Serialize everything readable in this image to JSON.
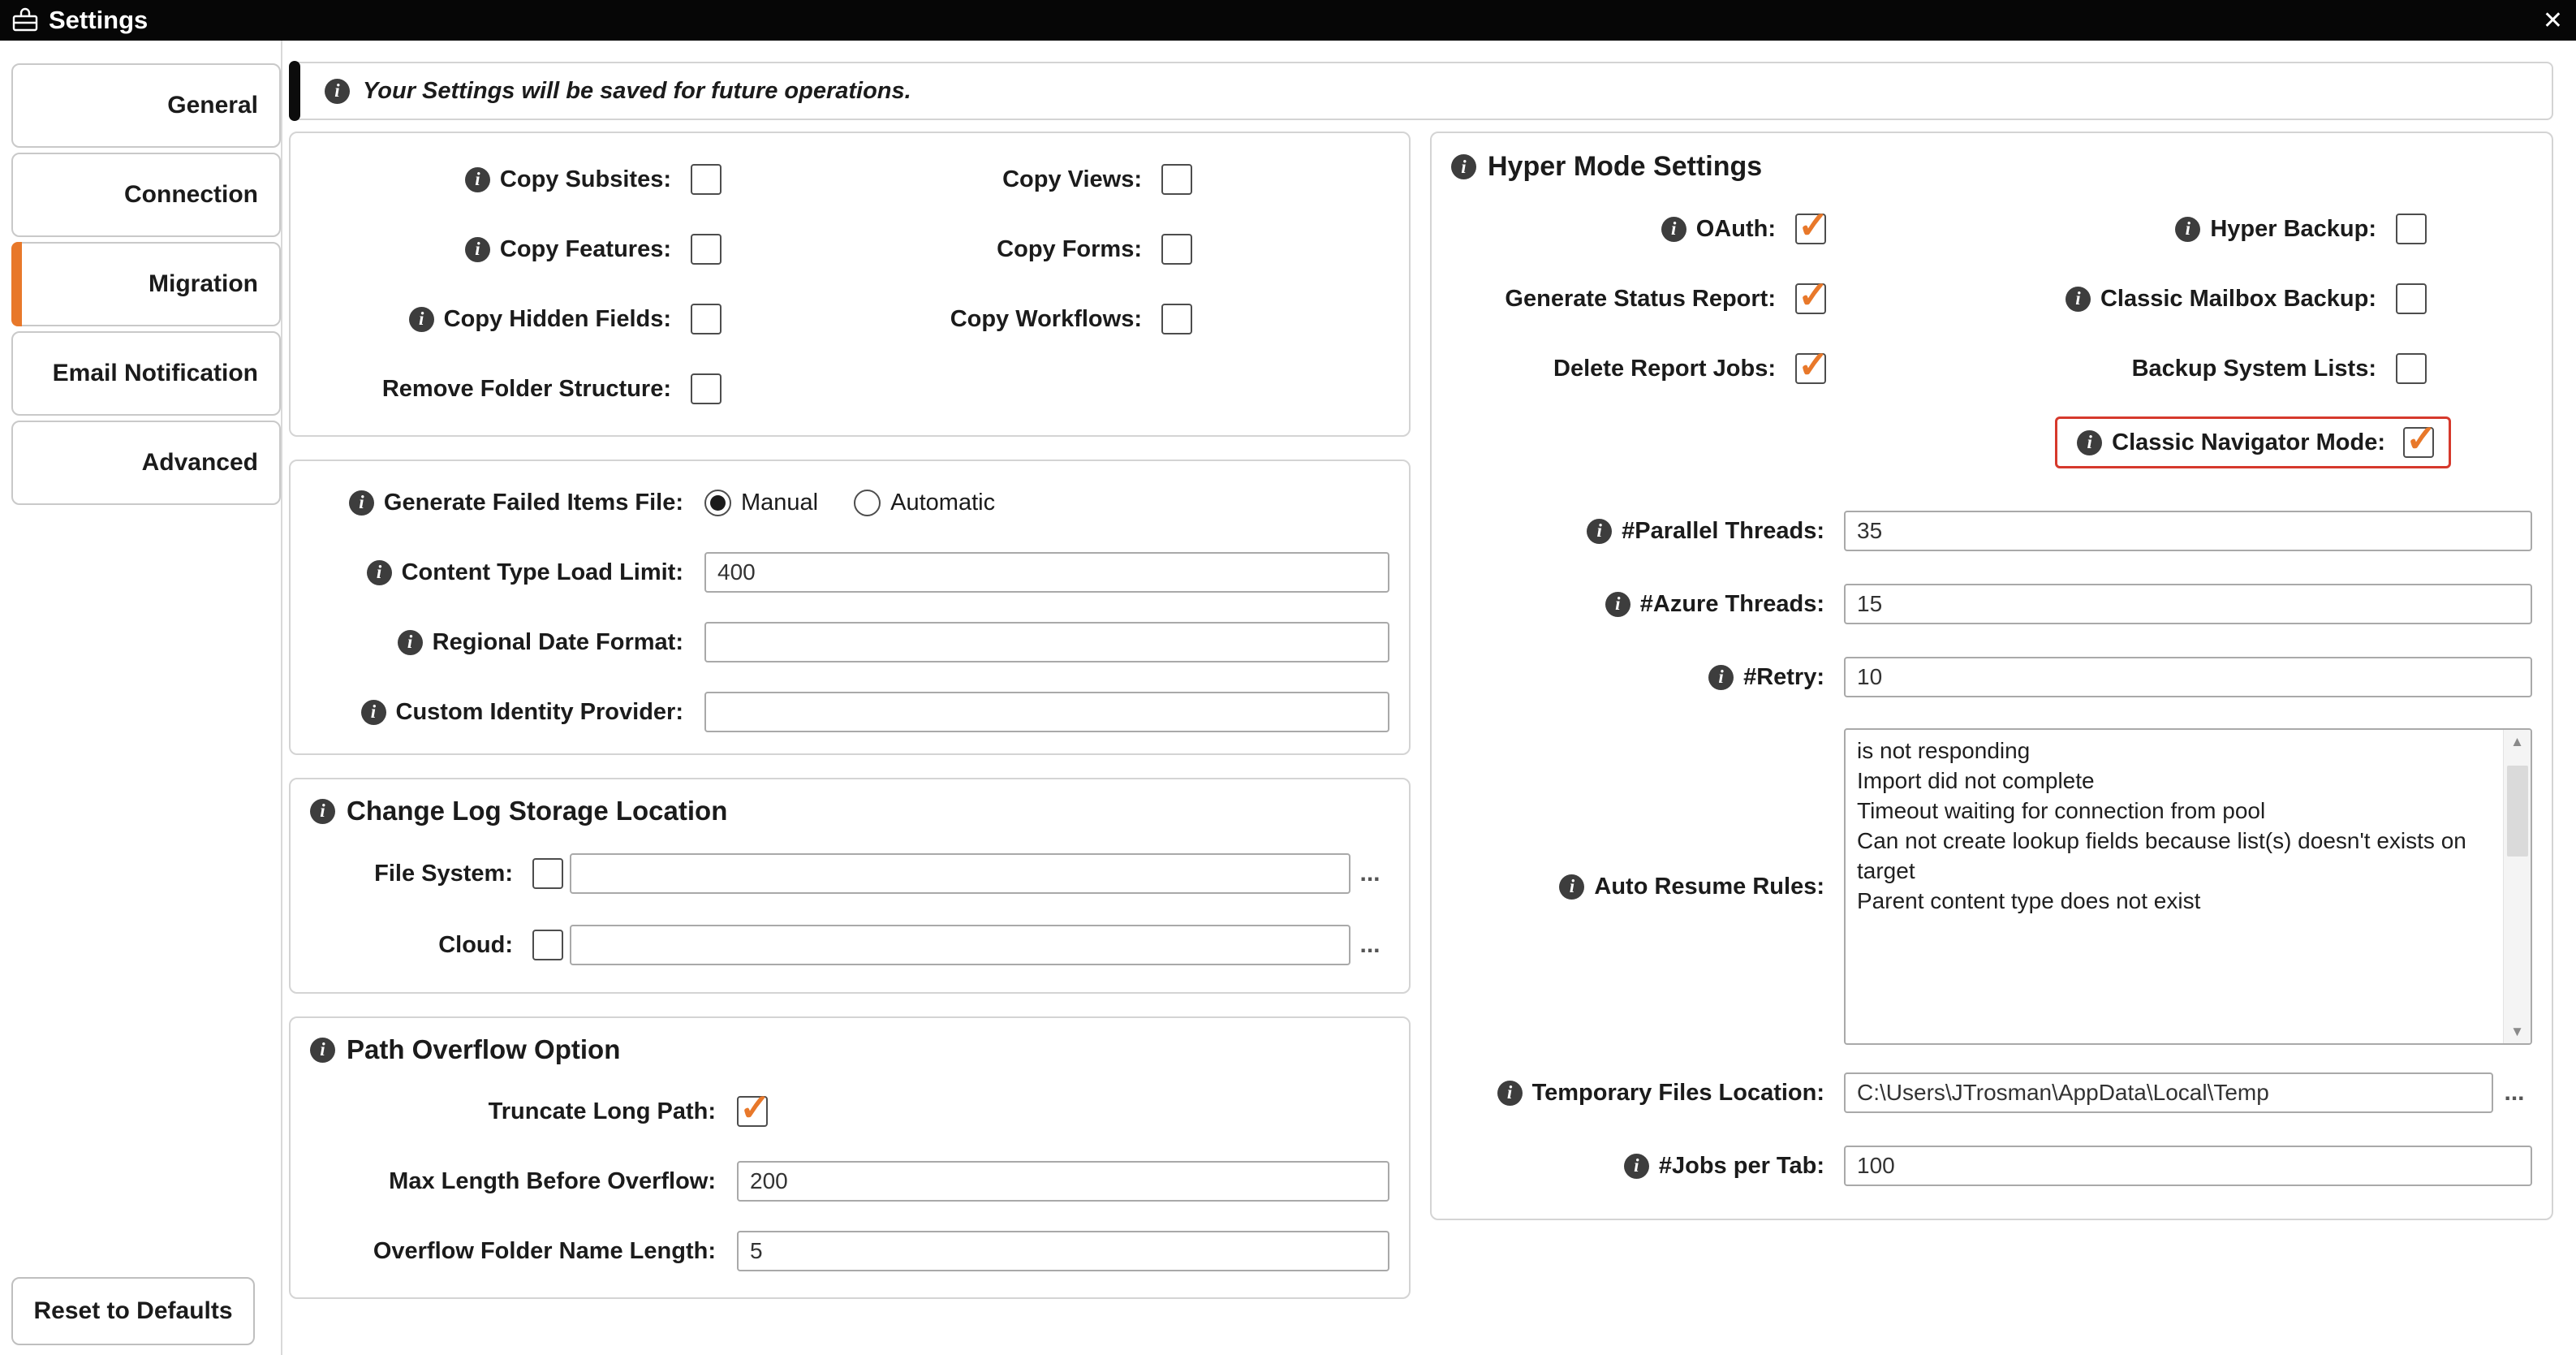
{
  "colors": {
    "accent": "#e8782a",
    "highlight": "#d6392c"
  },
  "titlebar": {
    "title": "Settings",
    "close_glyph": "✕"
  },
  "sidebar": {
    "tabs": [
      {
        "label": "General",
        "selected": false
      },
      {
        "label": "Connection",
        "selected": false
      },
      {
        "label": "Migration",
        "selected": true
      },
      {
        "label": "Email Notification",
        "selected": false
      },
      {
        "label": "Advanced",
        "selected": false
      }
    ],
    "reset_button_label": "Reset to Defaults"
  },
  "banner": {
    "text": "Your Settings will be saved for future operations."
  },
  "copy_options": {
    "rows": [
      {
        "left": {
          "label": "Copy Subsites:",
          "checked": false
        },
        "right": {
          "label": "Copy Views:",
          "checked": false
        }
      },
      {
        "left": {
          "label": "Copy Features:",
          "checked": false
        },
        "right": {
          "label": "Copy Forms:",
          "checked": false
        }
      },
      {
        "left": {
          "label": "Copy Hidden Fields:",
          "checked": false
        },
        "right": {
          "label": "Copy Workflows:",
          "checked": false
        }
      },
      {
        "left": {
          "label": "Remove Folder Structure:",
          "checked": false
        }
      }
    ]
  },
  "failed_items": {
    "generate_label": "Generate Failed Items File:",
    "manual_label": "Manual",
    "manual_selected": true,
    "automatic_label": "Automatic",
    "automatic_selected": false,
    "content_type_label": "Content Type Load Limit:",
    "content_type_value": "400",
    "regional_date_label": "Regional Date Format:",
    "regional_date_value": "",
    "identity_provider_label": "Custom Identity Provider:",
    "identity_provider_value": ""
  },
  "change_log": {
    "title": "Change Log Storage Location",
    "file_system_label": "File System:",
    "file_system_checked": false,
    "file_system_value": "",
    "cloud_label": "Cloud:",
    "cloud_checked": false,
    "cloud_value": "",
    "browse_label": "..."
  },
  "path_overflow": {
    "title": "Path Overflow Option",
    "truncate_label": "Truncate Long Path:",
    "truncate_checked": true,
    "max_length_label": "Max Length Before Overflow:",
    "max_length_value": "200",
    "folder_name_label": "Overflow Folder Name Length:",
    "folder_name_value": "5"
  },
  "hyper_mode": {
    "title": "Hyper Mode Settings",
    "rows": [
      {
        "left": {
          "label": "OAuth:",
          "checked": true
        },
        "right": {
          "label": "Hyper Backup:",
          "checked": false
        }
      },
      {
        "left": {
          "label": "Generate Status Report:",
          "checked": true
        },
        "right": {
          "label": "Classic Mailbox Backup:",
          "checked": false
        }
      },
      {
        "left": {
          "label": "Delete Report Jobs:",
          "checked": true
        },
        "right": {
          "label": "Backup System Lists:",
          "checked": false
        }
      },
      {
        "right": {
          "label": "Classic Navigator Mode:",
          "checked": true,
          "highlighted": true
        }
      }
    ],
    "parallel_label": "#Parallel Threads:",
    "parallel_value": "35",
    "azure_label": "#Azure Threads:",
    "azure_value": "15",
    "retry_label": "#Retry:",
    "retry_value": "10",
    "auto_resume_label": "Auto Resume Rules:",
    "auto_resume_value": "is not responding\nImport did not complete\nTimeout waiting for connection from pool\nCan not create lookup fields because list(s) doesn't exists on target\nParent content type does not exist",
    "temp_label": "Temporary Files Location:",
    "temp_value": "C:\\Users\\JTrosman\\AppData\\Local\\Temp",
    "browse_label": "...",
    "jobs_label": "#Jobs per Tab:",
    "jobs_value": "100"
  }
}
